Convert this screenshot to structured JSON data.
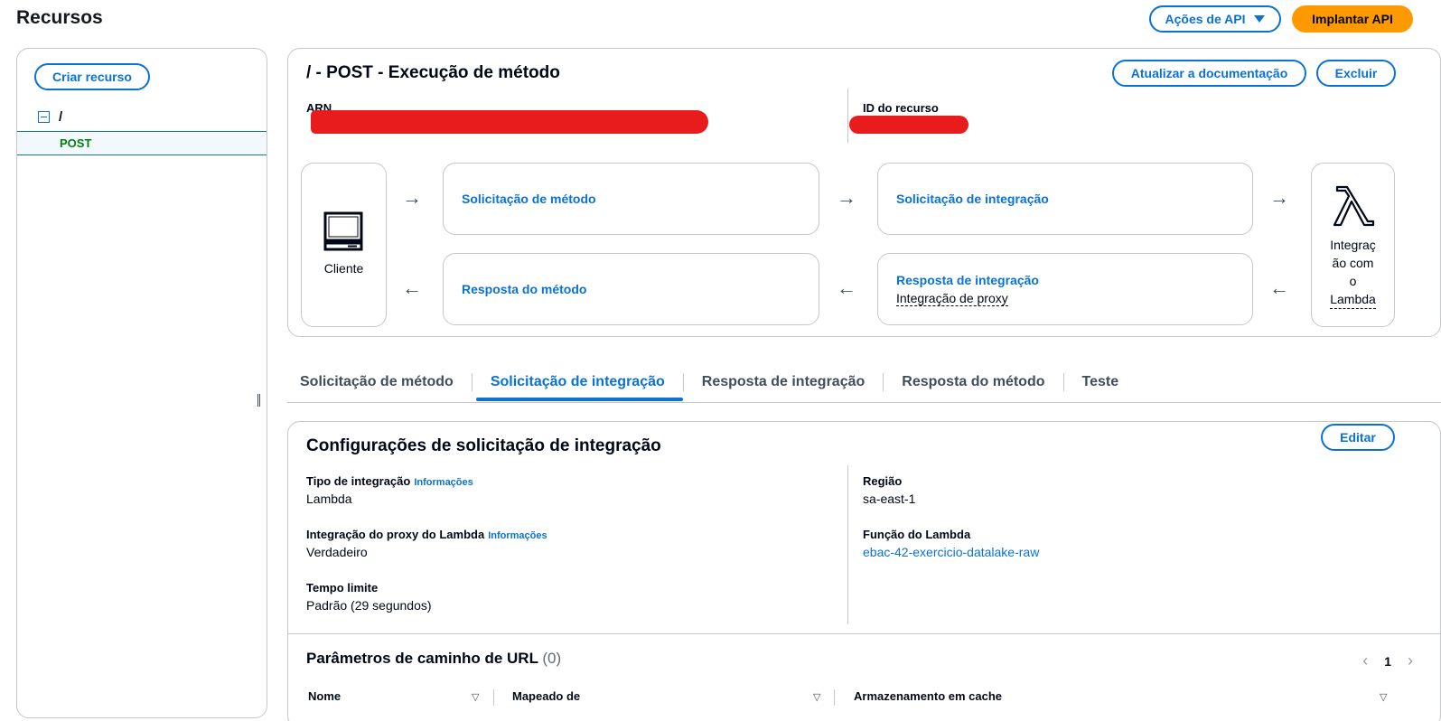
{
  "page": {
    "title": "Recursos"
  },
  "top_actions": {
    "api_actions": "Ações de API",
    "deploy": "Implantar API"
  },
  "resources": {
    "create": "Criar recurso",
    "root": "/",
    "method": "POST"
  },
  "method_header": {
    "title": "/ - POST - Execução de método",
    "update_docs": "Atualizar a documentação",
    "delete": "Excluir",
    "arn_label": "ARN",
    "resource_id_label": "ID do recurso"
  },
  "flow": {
    "client": "Cliente",
    "method_request": "Solicitação de método",
    "integration_request": "Solicitação de integração",
    "method_response": "Resposta do método",
    "integration_response": "Resposta de integração",
    "integration_response_sub": "Integração de proxy",
    "lambda_line1": "Integraç",
    "lambda_line2": "ão com",
    "lambda_line3": "o",
    "lambda_line4": "Lambda"
  },
  "tabs": [
    {
      "label": "Solicitação de método",
      "active": false
    },
    {
      "label": "Solicitação de integração",
      "active": true
    },
    {
      "label": "Resposta de integração",
      "active": false
    },
    {
      "label": "Resposta do método",
      "active": false
    },
    {
      "label": "Teste",
      "active": false
    }
  ],
  "config": {
    "title": "Configurações de solicitação de integração",
    "edit": "Editar",
    "integration_type_label": "Tipo de integração",
    "integration_type_value": "Lambda",
    "info": "Informações",
    "proxy_label": "Integração do proxy do Lambda",
    "proxy_value": "Verdadeiro",
    "timeout_label": "Tempo limite",
    "timeout_value": "Padrão (29 segundos)",
    "region_label": "Região",
    "region_value": "sa-east-1",
    "function_label": "Função do Lambda",
    "function_value": "ebac-42-exercicio-datalake-raw"
  },
  "url_params": {
    "title": "Parâmetros de caminho de URL",
    "count": "(0)",
    "page": "1",
    "columns": [
      "Nome",
      "Mapeado de",
      "Armazenamento em cache"
    ]
  },
  "colors": {
    "accent": "#0972d3",
    "primary": "#ff9900",
    "method_green": "#037f0c",
    "redaction": "#e81c1c"
  },
  "icons": [
    "copy-icon",
    "monitor-icon",
    "lambda-icon",
    "arrow-right-icon",
    "arrow-left-icon",
    "caret-down-icon",
    "collapse-icon",
    "sort-icon",
    "chevron-left-icon",
    "chevron-right-icon"
  ]
}
